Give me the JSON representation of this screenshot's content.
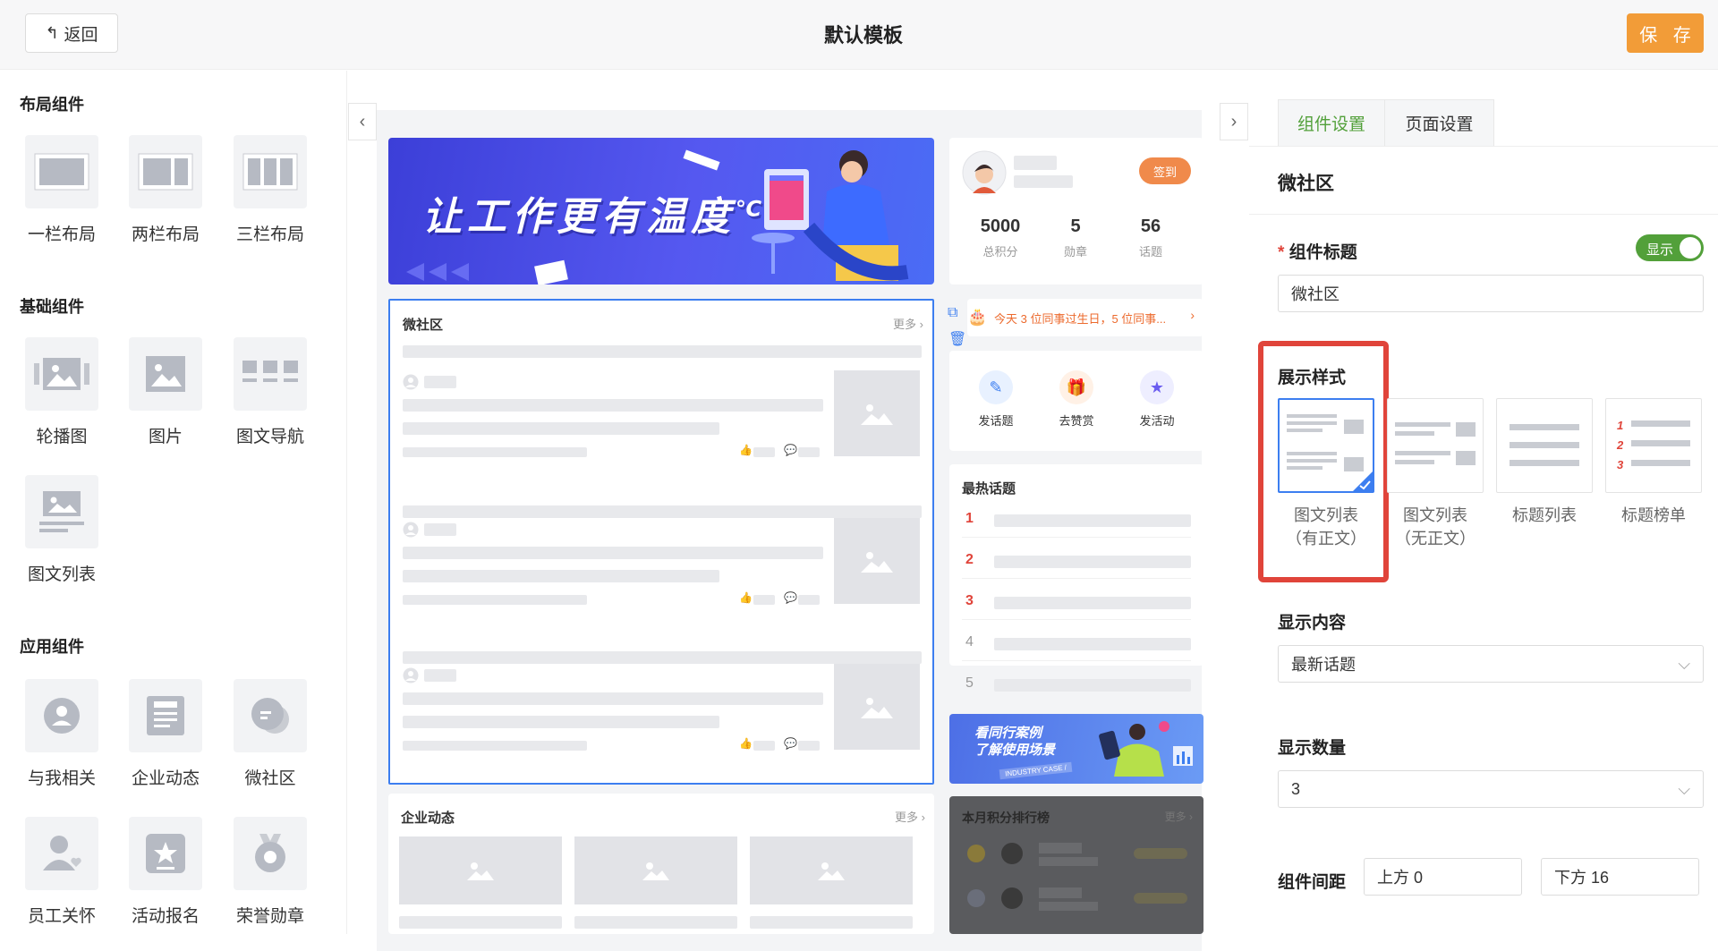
{
  "header": {
    "back_label": "返回",
    "title": "默认模板",
    "save_label": "保 存"
  },
  "left_panel": {
    "layout_title": "布局组件",
    "layout_items": [
      "一栏布局",
      "两栏布局",
      "三栏布局"
    ],
    "basic_title": "基础组件",
    "basic_items": [
      "轮播图",
      "图片",
      "图文导航",
      "图文列表"
    ],
    "app_title": "应用组件",
    "app_items": [
      "与我相关",
      "企业动态",
      "微社区",
      "员工关怀",
      "活动报名",
      "荣誉勋章"
    ]
  },
  "preview": {
    "banner_text": "让工作更有温度",
    "banner_unit": "℃",
    "profile": {
      "checkin": "签到",
      "stats": [
        {
          "value": "5000",
          "label": "总积分"
        },
        {
          "value": "5",
          "label": "勋章"
        },
        {
          "value": "56",
          "label": "话题"
        }
      ]
    },
    "community": {
      "title": "微社区",
      "more": "更多"
    },
    "birthday_notice": "今天 3 位同事过生日，5 位同事...",
    "actions": [
      "发话题",
      "去赞赏",
      "发活动"
    ],
    "hot_topics": {
      "title": "最热话题",
      "ranks": [
        "1",
        "2",
        "3",
        "4",
        "5"
      ]
    },
    "case_banner": {
      "line1": "看同行案例",
      "line2": "了解使用场景",
      "tag": "INDUSTRY CASE /"
    },
    "company_news": {
      "title": "企业动态",
      "more": "更多"
    },
    "points_rank": {
      "title": "本月积分排行榜",
      "more": "更多"
    }
  },
  "right_panel": {
    "tabs": [
      "组件设置",
      "页面设置"
    ],
    "active_tab": 0,
    "component_name": "微社区",
    "title_label": "组件标题",
    "required_mark": "*",
    "toggle_label": "显示",
    "title_value": "微社区",
    "style_label": "展示样式",
    "styles": [
      {
        "line1": "图文列表",
        "line2": "（有正文）"
      },
      {
        "line1": "图文列表",
        "line2": "（无正文）"
      },
      {
        "line1": "标题列表",
        "line2": ""
      },
      {
        "line1": "标题榜单",
        "line2": ""
      }
    ],
    "selected_style": 0,
    "content_label": "显示内容",
    "content_value": "最新话题",
    "count_label": "显示数量",
    "count_value": "3",
    "spacing_label": "组件间距",
    "spacing_top": "上方 0",
    "spacing_bottom": "下方 16"
  },
  "colors": {
    "accent_green": "#52a03a",
    "save_orange": "#f29c38",
    "highlight_red": "#e0443a",
    "select_blue": "#3c7ef0"
  }
}
